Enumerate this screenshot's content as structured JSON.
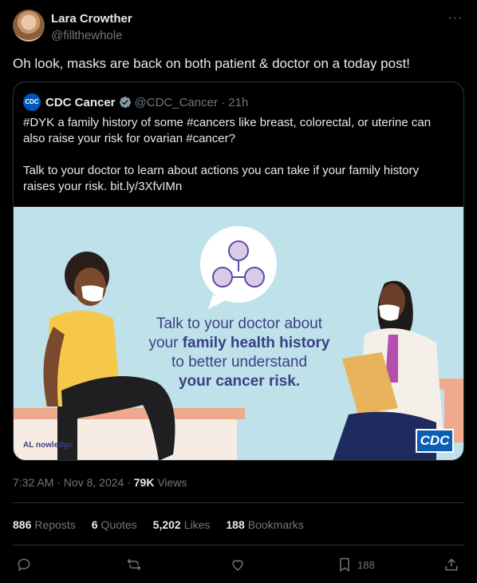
{
  "author": {
    "name": "Lara Crowther",
    "handle": "@fillthewhole"
  },
  "tweet": {
    "text": "Oh look, masks are back on both patient & doctor on a today post!"
  },
  "quote": {
    "logo_text": "CDC",
    "logo_sub": "Cancer",
    "name": "CDC Cancer",
    "handle_time": "@CDC_Cancer · 21h",
    "text": "#DYK a family history of some #cancers like breast, colorectal, or uterine can also raise your risk for ovarian #cancer?\n\nTalk to your doctor to learn about actions you can take if your family history raises your risk. bit.ly/3XfvIMn",
    "image": {
      "line1": "Talk to your doctor about",
      "line2_pre": "your ",
      "line2_bold": "family health history",
      "line3": "to better understand",
      "line4": "your cancer risk.",
      "badge": "CDC",
      "corner_logo": "AL nowledge"
    }
  },
  "meta": {
    "timestamp": "7:32 AM · Nov 8, 2024 · ",
    "views_count": "79K",
    "views_label": " Views"
  },
  "stats": {
    "reposts": {
      "count": "886",
      "label": "Reposts"
    },
    "quotes": {
      "count": "6",
      "label": "Quotes"
    },
    "likes": {
      "count": "5,202",
      "label": "Likes"
    },
    "bookmarks": {
      "count": "188",
      "label": "Bookmarks"
    }
  },
  "actions": {
    "bookmark_count": "188"
  },
  "icons": [
    "more-icon",
    "verified-icon",
    "reply-icon",
    "repost-icon",
    "like-icon",
    "bookmark-icon",
    "share-icon"
  ],
  "colors": {
    "background": "#000000",
    "text": "#e7e9ea",
    "muted": "#71767b",
    "border": "#2f3336",
    "verified": "#829aab",
    "banner_text": "#3a3f86"
  }
}
